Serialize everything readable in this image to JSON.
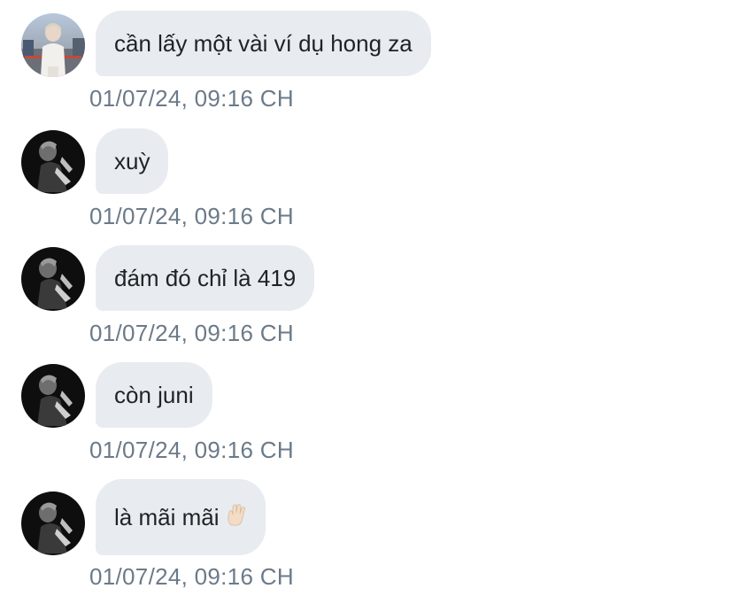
{
  "messages": [
    {
      "sender": "user",
      "text": "cần lấy một vài ví dụ hong za",
      "time": "01/07/24, 09:16 CH"
    },
    {
      "sender": "other",
      "text": "xuỳ",
      "time": "01/07/24, 09:16 CH"
    },
    {
      "sender": "other",
      "text": "đám đó chỉ là 419",
      "time": "01/07/24, 09:16 CH"
    },
    {
      "sender": "other",
      "text": "còn juni",
      "time": "01/07/24, 09:16 CH"
    },
    {
      "sender": "other",
      "text": "là mãi mãi",
      "time": "01/07/24, 09:16 CH",
      "emoji": "raised-hand-emoji"
    }
  ],
  "colors": {
    "bubble": "#e8ecf0",
    "text": "#1f2326",
    "timestamp": "#6b7a89"
  }
}
